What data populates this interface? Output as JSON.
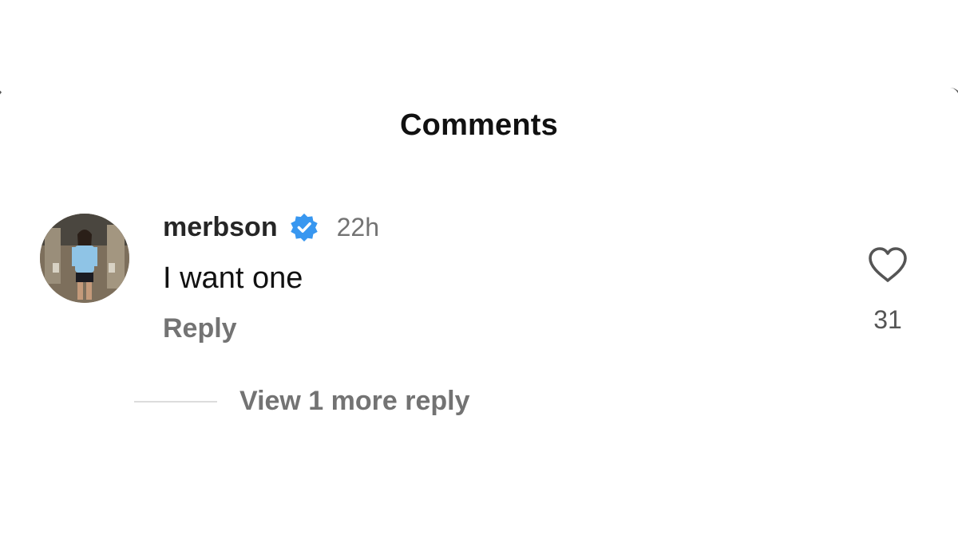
{
  "sheet": {
    "title": "Comments"
  },
  "comment": {
    "username": "merbson",
    "verified": true,
    "timestamp": "22h",
    "text": "I want one",
    "reply_label": "Reply",
    "like_count": "31",
    "view_replies_label": "View 1 more reply"
  },
  "icons": {
    "verified": "verified-badge-icon",
    "like": "heart-icon"
  },
  "colors": {
    "verified_blue": "#3897f0",
    "muted_text": "#737373"
  }
}
